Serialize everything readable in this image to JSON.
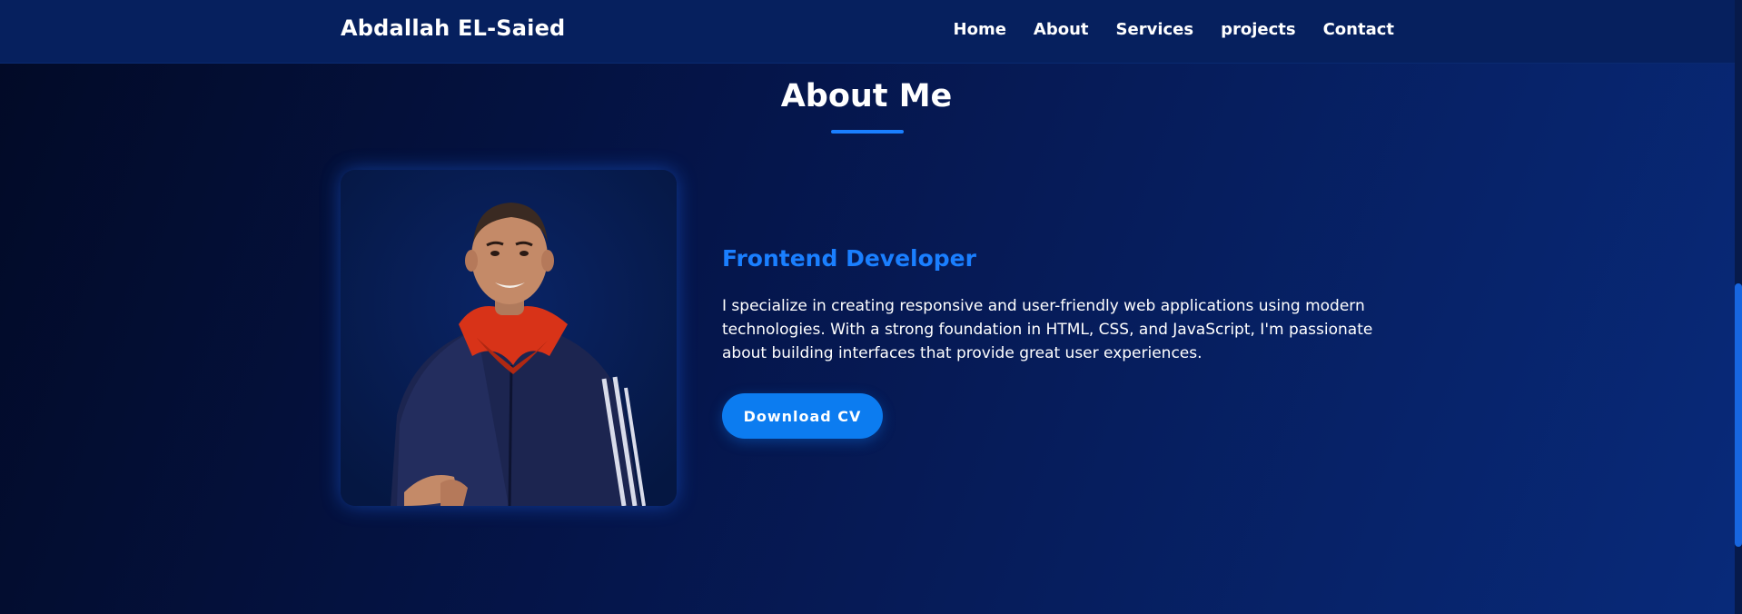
{
  "header": {
    "brand": "Abdallah EL-Saied",
    "nav": [
      {
        "label": "Home"
      },
      {
        "label": "About"
      },
      {
        "label": "Services"
      },
      {
        "label": "projects"
      },
      {
        "label": "Contact"
      }
    ]
  },
  "about": {
    "title": "About Me",
    "role": "Frontend Developer",
    "bio": "I specialize in creating responsive and user-friendly web applications using modern technologies. With a strong foundation in HTML, CSS, and JavaScript, I'm passionate about building interfaces that provide great user experiences.",
    "cv_button": "Download CV"
  },
  "colors": {
    "accent": "#1a7fff",
    "button": "#0c7cf0",
    "nav_background": "#06205e"
  }
}
